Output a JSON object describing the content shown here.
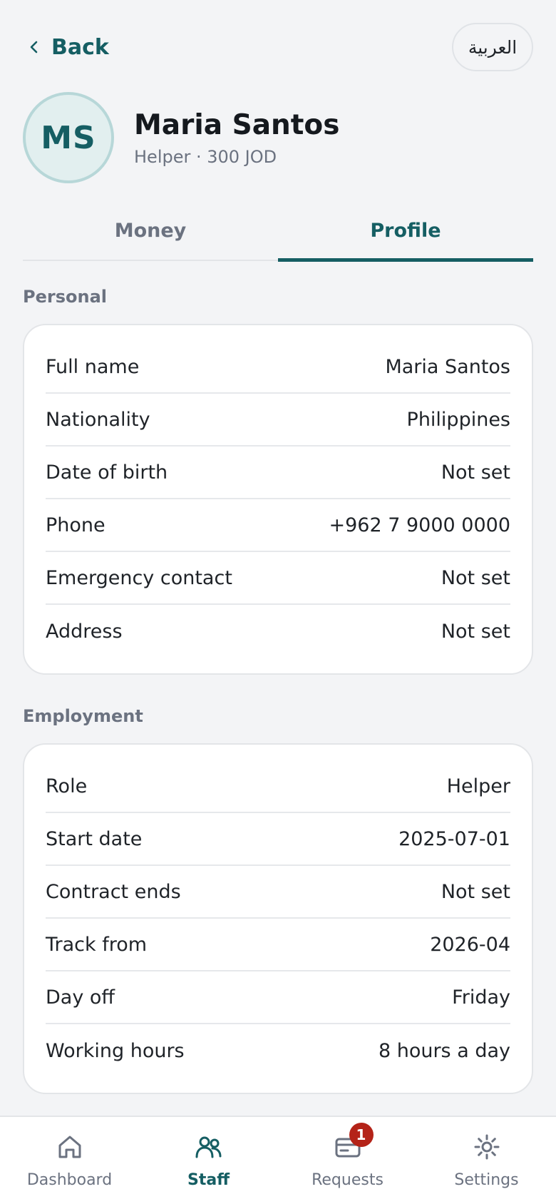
{
  "topbar": {
    "back_label": "Back",
    "language_label": "العربية"
  },
  "profile": {
    "initials": "MS",
    "name": "Maria Santos",
    "subtitle": "Helper · 300 JOD"
  },
  "tabs": [
    {
      "label": "Money"
    },
    {
      "label": "Profile",
      "active": true
    }
  ],
  "personal": {
    "title": "Personal",
    "rows": [
      {
        "label": "Full name",
        "value": "Maria Santos"
      },
      {
        "label": "Nationality",
        "value": "Philippines"
      },
      {
        "label": "Date of birth",
        "value": "Not set"
      },
      {
        "label": "Phone",
        "value": "+962 7 9000 0000"
      },
      {
        "label": "Emergency contact",
        "value": "Not set"
      },
      {
        "label": "Address",
        "value": "Not set"
      }
    ]
  },
  "employment": {
    "title": "Employment",
    "rows": [
      {
        "label": "Role",
        "value": "Helper"
      },
      {
        "label": "Start date",
        "value": "2025-07-01"
      },
      {
        "label": "Contract ends",
        "value": "Not set"
      },
      {
        "label": "Track from",
        "value": "2026-04"
      },
      {
        "label": "Day off",
        "value": "Friday"
      },
      {
        "label": "Working hours",
        "value": "8 hours a day"
      }
    ]
  },
  "nav": {
    "items": [
      {
        "label": "Dashboard",
        "icon": "home-icon"
      },
      {
        "label": "Staff",
        "icon": "users-icon",
        "active": true
      },
      {
        "label": "Requests",
        "icon": "card-icon",
        "badge": "1"
      },
      {
        "label": "Settings",
        "icon": "gear-icon"
      }
    ]
  },
  "colors": {
    "accent": "#155e63",
    "badge": "#b42318",
    "background": "#f3f4f6"
  }
}
